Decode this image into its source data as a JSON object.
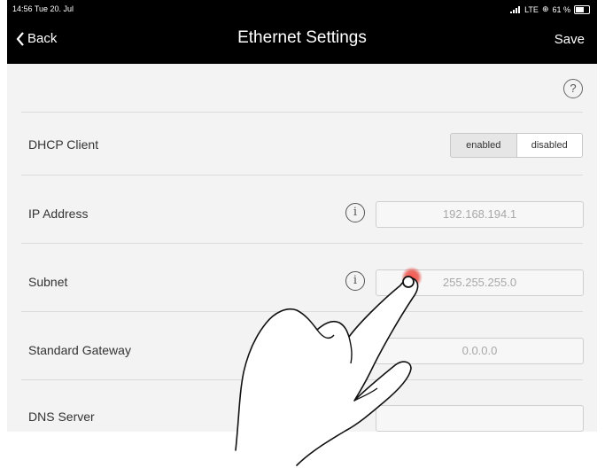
{
  "status": {
    "time": "14:56  Tue 20. Jul",
    "network": "LTE",
    "battery": "61 %",
    "battery_level": 0.61
  },
  "nav": {
    "back_label": "Back",
    "title": "Ethernet Settings",
    "save_label": "Save"
  },
  "help_glyph": "?",
  "dhcp": {
    "label": "DHCP Client",
    "options": [
      "enabled",
      "disabled"
    ],
    "selected": "disabled"
  },
  "fields": {
    "ip": {
      "label": "IP Address",
      "value": "192.168.194.1"
    },
    "subnet": {
      "label": "Subnet",
      "value": "255.255.255.0"
    },
    "gateway": {
      "label": "Standard Gateway",
      "value": "0.0.0.0"
    },
    "dns": {
      "label": "DNS Server",
      "value": ""
    }
  },
  "info_glyph": "i",
  "colors": {
    "bar": "#000000",
    "background": "#f3f3f3",
    "tap_indicator": "#e8332a"
  }
}
